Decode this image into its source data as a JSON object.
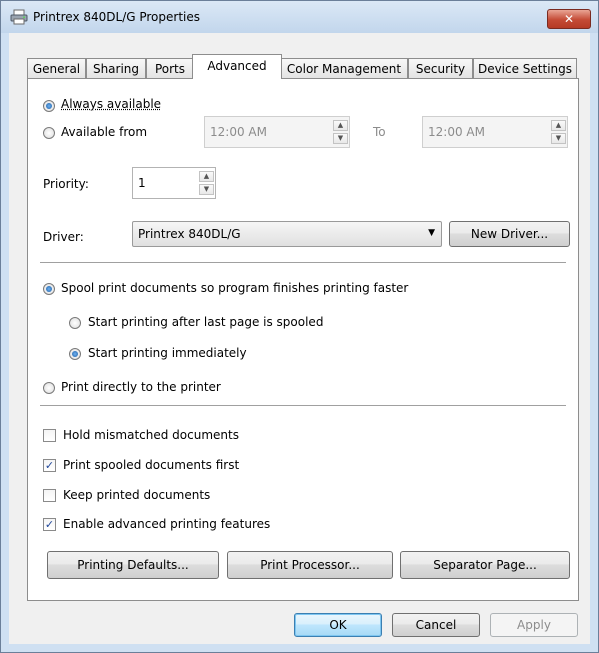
{
  "window": {
    "title": "Printrex 840DL/G Properties",
    "close_glyph": "✕"
  },
  "tabs": [
    {
      "label": "General"
    },
    {
      "label": "Sharing"
    },
    {
      "label": "Ports"
    },
    {
      "label": "Advanced"
    },
    {
      "label": "Color Management"
    },
    {
      "label": "Security"
    },
    {
      "label": "Device Settings"
    }
  ],
  "active_tab": "Advanced",
  "availability": {
    "always_label": "Always available",
    "from_label": "Available from",
    "selected": "always",
    "from_time": "12:00 AM",
    "to_label": "To",
    "to_time": "12:00 AM"
  },
  "priority": {
    "label": "Priority:",
    "value": "1"
  },
  "driver": {
    "label": "Driver:",
    "value": "Printrex 840DL/G",
    "new_driver_label": "New Driver..."
  },
  "spool": {
    "spool_label": "Spool print documents so program finishes printing faster",
    "after_last_label": "Start printing after last page is spooled",
    "immediately_label": "Start printing immediately",
    "direct_label": "Print directly to the printer",
    "mode": "spool",
    "start": "immediately"
  },
  "options": [
    {
      "label": "Hold mismatched documents",
      "checked": false
    },
    {
      "label": "Print spooled documents first",
      "checked": true
    },
    {
      "label": "Keep printed documents",
      "checked": false
    },
    {
      "label": "Enable advanced printing features",
      "checked": true
    }
  ],
  "bottom_buttons": {
    "printing_defaults": "Printing Defaults...",
    "print_processor": "Print Processor...",
    "separator_page": "Separator Page..."
  },
  "dialog_buttons": {
    "ok": "OK",
    "cancel": "Cancel",
    "apply": "Apply"
  },
  "check_glyph": "✓"
}
